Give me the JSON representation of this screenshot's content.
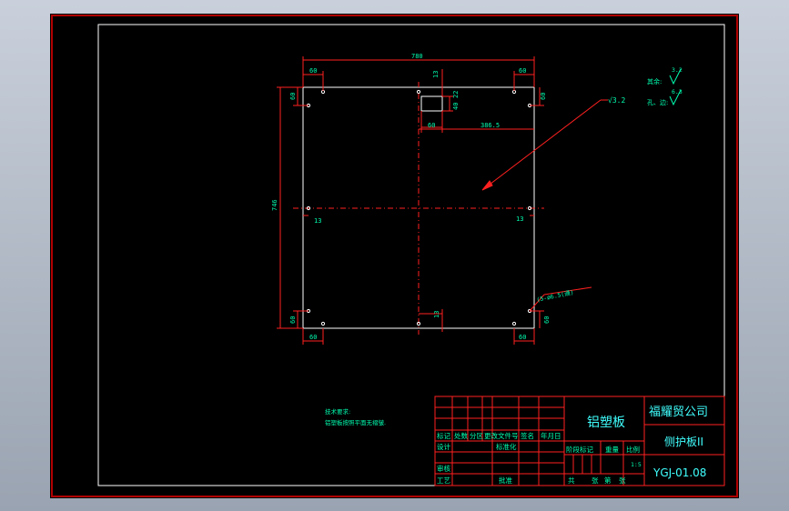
{
  "colors": {
    "background": "#000000",
    "frame_outer": "#b00000",
    "border": "#ffffff",
    "dimension": "#ff2020",
    "text_green": "#00ffb0",
    "title_cyan": "#40ffff",
    "table_red": "#ff2020"
  },
  "drawing": {
    "dims": {
      "overall_width": "780",
      "overall_height": "746",
      "left_top_offset": "60",
      "right_top_offset": "60",
      "left_bottom_offset": "60",
      "right_bottom_offset": "60",
      "left_top_vertical": "60",
      "right_top_vertical": "60",
      "left_bottom_vertical": "60",
      "right_bottom_vertical": "60",
      "notch_top_gap": "13",
      "notch_width": "60",
      "notch_height": "40",
      "notch_small": "22",
      "center_distance": "386.5",
      "mid_left": "13",
      "mid_right": "13",
      "bottom_center": "13",
      "hole_callout": "(5-ø6.5(通)"
    },
    "roughness": {
      "label_1": "其余:",
      "value_1": "3.2",
      "label_2": "孔、边:",
      "value_2": "6.3",
      "callout": "√3.2"
    },
    "notes": {
      "title": "技术要求:",
      "line_1": "铝塑板按照平面无褶皱."
    }
  },
  "title_block": {
    "part_name": "铝塑板",
    "company": "福耀贸公司",
    "drawing_title": "侧护板II",
    "drawing_number": "YGJ-01.08",
    "header_labels": [
      "标记",
      "处数",
      "分区",
      "更改文件号",
      "签名",
      "年月日"
    ],
    "design": "设计",
    "standardization": "标准化",
    "review": "审核",
    "process": "工艺",
    "approve": "批准",
    "stage_mark": "阶段标记",
    "weight": "重量",
    "scale": "比例",
    "scale_value": "1:5",
    "sheet_total": "共",
    "sheet_label": "张",
    "sheet_num": "第",
    "sheet_label_2": "张"
  }
}
